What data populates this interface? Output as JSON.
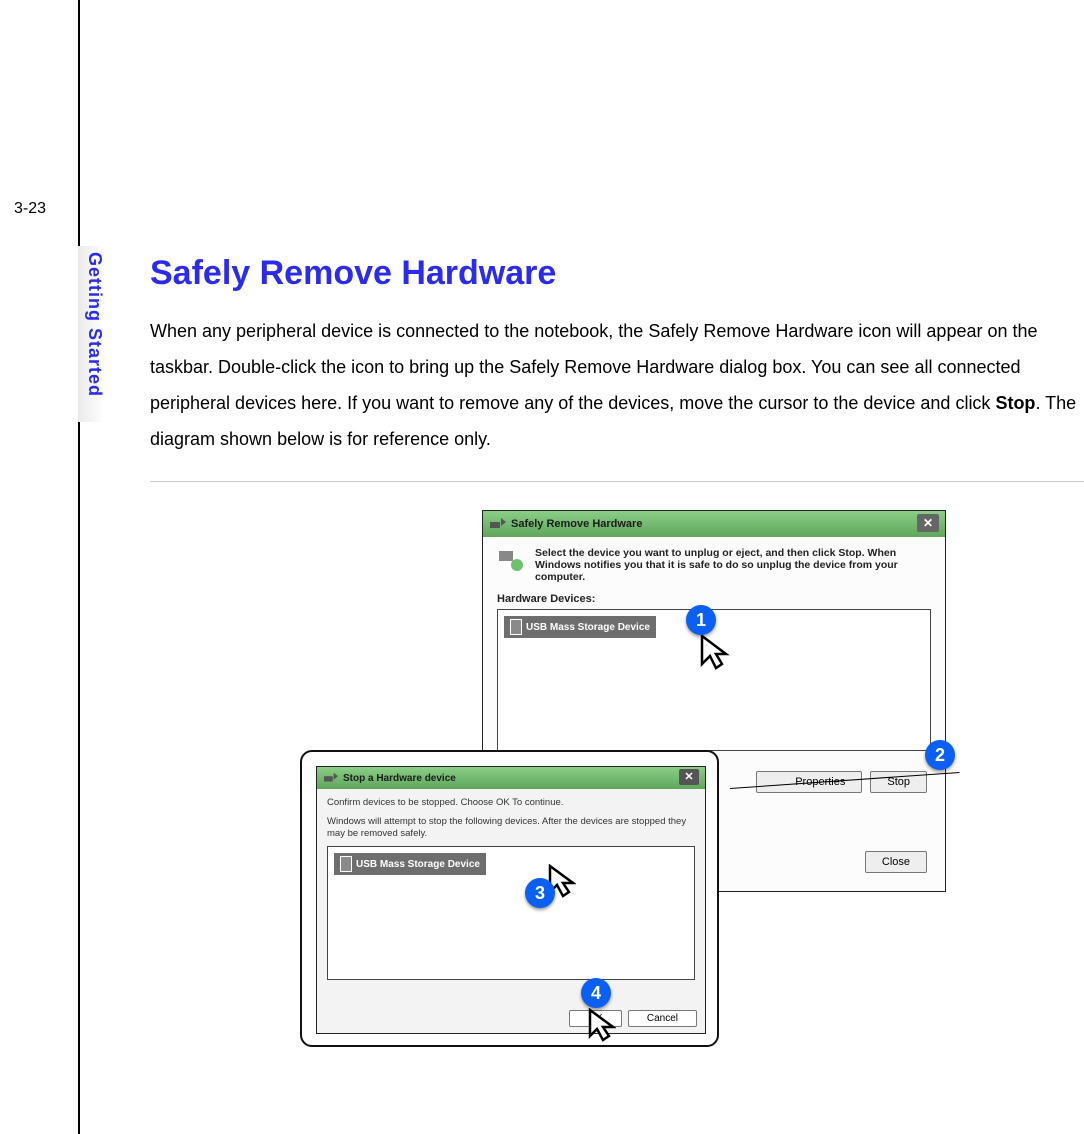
{
  "page_number": "3-23",
  "sidebar_label": "Getting Started",
  "title": "Safely Remove Hardware",
  "body_parts": {
    "p1": "When any peripheral device is connected to the notebook, the Safely Remove Hardware icon will appear on the taskbar.  Double-click the icon to bring up the Safely Remove Hardware dialog box. You can see all connected peripheral devices here.  If you want to remove any of the devices, move the cursor to the device and click ",
    "p1_bold": "Stop",
    "p1_tail": ".  The diagram shown below is for reference only."
  },
  "dialog1": {
    "title": "Safely Remove Hardware",
    "instruction": "Select the device you want to unplug or eject, and then click Stop. When Windows notifies you that it is safe to do so unplug the device from your computer.",
    "devices_label": "Hardware Devices:",
    "list_item": "USB Mass Storage Device",
    "properties_button": "Properties",
    "stop_button": "Stop",
    "close_button": "Close"
  },
  "dialog2": {
    "title": "Stop a Hardware device",
    "p1": "Confirm devices to be stopped.  Choose OK To continue.",
    "p2": "Windows will attempt to stop the following devices. After the devices are stopped they may be removed safely.",
    "list_item": "USB Mass Storage Device",
    "ok_button": "OK",
    "cancel_button": "Cancel"
  },
  "callouts": {
    "c1": "1",
    "c2": "2",
    "c3": "3",
    "c4": "4"
  }
}
